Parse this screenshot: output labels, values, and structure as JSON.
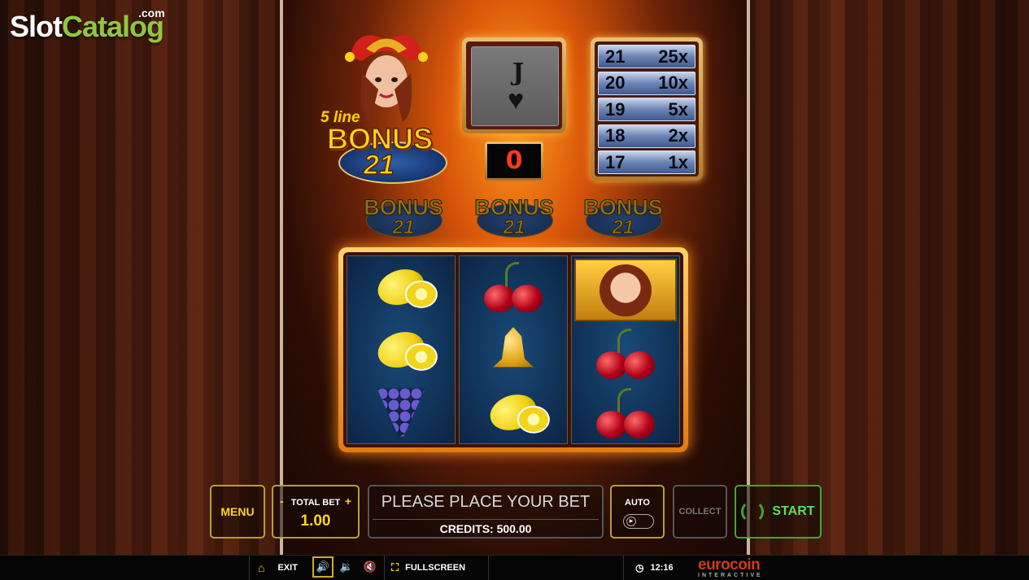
{
  "brand": {
    "logo_part1": "Slot",
    "logo_part2": "Catalog",
    "logo_suffix": ".com"
  },
  "game": {
    "title_prefix": "5 line",
    "title_word": "BONUS",
    "title_number": "21",
    "card_rank": "J",
    "card_suit": "♥",
    "counter": "0",
    "paytable": [
      {
        "points": "21",
        "multiplier": "25x"
      },
      {
        "points": "20",
        "multiplier": "10x"
      },
      {
        "points": "19",
        "multiplier": "5x"
      },
      {
        "points": "18",
        "multiplier": "2x"
      },
      {
        "points": "17",
        "multiplier": "1x"
      }
    ],
    "mini_logos": [
      {
        "word": "BONUS",
        "number": "21"
      },
      {
        "word": "BONUS",
        "number": "21"
      },
      {
        "word": "BONUS",
        "number": "21"
      }
    ],
    "reels": [
      [
        "lemon",
        "lemon",
        "grapes"
      ],
      [
        "cherries",
        "bell",
        "lemon"
      ],
      [
        "jester",
        "cherries",
        "cherries"
      ]
    ]
  },
  "controls": {
    "menu_label": "MENU",
    "total_bet_label": "TOTAL BET",
    "bet_minus": "-",
    "bet_plus": "+",
    "total_bet_value": "1.00",
    "message": "PLEASE PLACE YOUR BET",
    "credits_text": "CREDITS: 500.00",
    "auto_label": "AUTO",
    "collect_label": "COLLECT",
    "start_label": "START"
  },
  "bottom_bar": {
    "exit_label": "EXIT",
    "fullscreen_label": "FULLSCREEN",
    "time": "12:16",
    "provider_name": "eurocoin",
    "provider_sub": "INTERACTIVE"
  },
  "colors": {
    "accent": "#ffd21a",
    "start_green": "#3aa83a",
    "counter_red": "#ff3a1a"
  }
}
